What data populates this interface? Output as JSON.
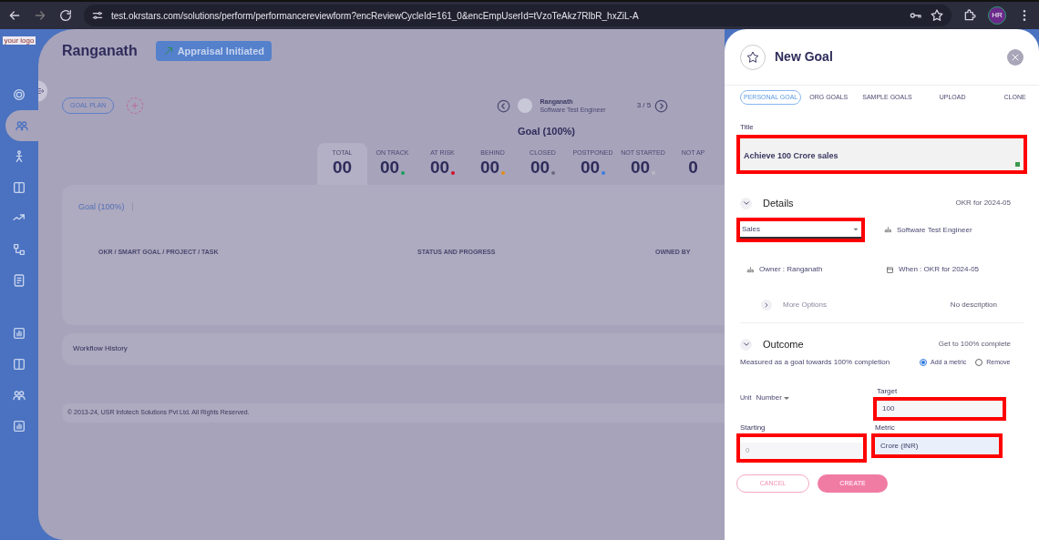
{
  "browser": {
    "url": "test.okrstars.com/solutions/perform/performancereviewform?encReviewCycleId=161_0&encEmpUserId=tVzoTeAkz7RlbR_hxZiL-A",
    "profile_initials": "HR"
  },
  "sidebar": {
    "logo": "your logo",
    "items": [
      {
        "selected": false
      },
      {
        "selected": true
      },
      {
        "selected": false
      },
      {
        "selected": false
      },
      {
        "selected": false
      },
      {
        "selected": false
      },
      {
        "selected": false
      },
      {
        "selected": false
      },
      {
        "selected": false
      },
      {
        "selected": false
      },
      {
        "selected": false
      }
    ]
  },
  "page": {
    "name": "Ranganath",
    "status_badge": "Appraisal Initiated",
    "goal_plan_button": "GOAL PLAN",
    "employee": {
      "name": "Ranganath",
      "role": "Software Test Engineer",
      "pager": "3 / 5"
    },
    "summary_title": "Goal (100%)",
    "stats": [
      {
        "label": "TOTAL",
        "value": "00",
        "selected": true
      },
      {
        "label": "ON TRACK",
        "value": "00",
        "color": "#1aa05a",
        "selected": false
      },
      {
        "label": "AT RISK",
        "value": "00",
        "color": "#d0102a",
        "selected": false
      },
      {
        "label": "BEHIND",
        "value": "00",
        "color": "#e0901a",
        "selected": false
      },
      {
        "label": "CLOSED",
        "value": "00",
        "color": "#6b6b80",
        "selected": false
      },
      {
        "label": "POSTPONED",
        "value": "00",
        "color": "#3a7ce0",
        "selected": false
      },
      {
        "label": "NOT STARTED",
        "value": "00",
        "color": "#b8b8c4",
        "selected": false
      },
      {
        "label": "NOT AP",
        "value": "0",
        "selected": false
      }
    ],
    "goal_card": {
      "tab": "Goal (100%)",
      "columns": [
        "OKR / SMART GOAL / PROJECT / TASK",
        "STATUS AND PROGRESS",
        "OWNED BY"
      ]
    },
    "workflow": "Workflow History",
    "footer": "© 2013-24, USR Infotech Solutions Pvt Ltd. All Rights Reserved."
  },
  "panel": {
    "title": "New Goal",
    "tabs": [
      {
        "label": "PERSONAL GOAL",
        "selected": true
      },
      {
        "label": "ORG GOALS",
        "selected": false
      },
      {
        "label": "SAMPLE GOALS",
        "selected": false
      },
      {
        "label": "UPLOAD",
        "selected": false
      },
      {
        "label": "CLONE",
        "selected": false
      }
    ],
    "title_field": {
      "label": "Title",
      "value": "Achieve 100 Crore sales",
      "highlighted": true
    },
    "details": {
      "heading": "Details",
      "expanded": true,
      "period": "OKR for 2024-05",
      "category": {
        "value": "Sales",
        "highlighted": true
      },
      "role": "Software Test Engineer",
      "owner": "Owner : Ranganath",
      "when": "When : OKR for 2024-05",
      "more_options": "More Options",
      "description": "No description"
    },
    "outcome": {
      "heading": "Outcome",
      "expanded": true,
      "note": "Get to 100% complete",
      "measured": "Measured as a goal towards 100% completion",
      "radios": [
        {
          "label": "Add a metric",
          "selected": true
        },
        {
          "label": "Remove",
          "selected": false
        }
      ],
      "unit_label": "Unit",
      "unit": "Number",
      "target": {
        "label": "Target",
        "value": "100",
        "highlighted": true
      },
      "starting": {
        "label": "Starting",
        "placeholder": "0",
        "highlighted": true
      },
      "metric": {
        "label": "Metric",
        "value": "Crore (INR)",
        "highlighted": true
      }
    },
    "buttons": {
      "cancel": "CANCEL",
      "create": "CREATE"
    }
  }
}
